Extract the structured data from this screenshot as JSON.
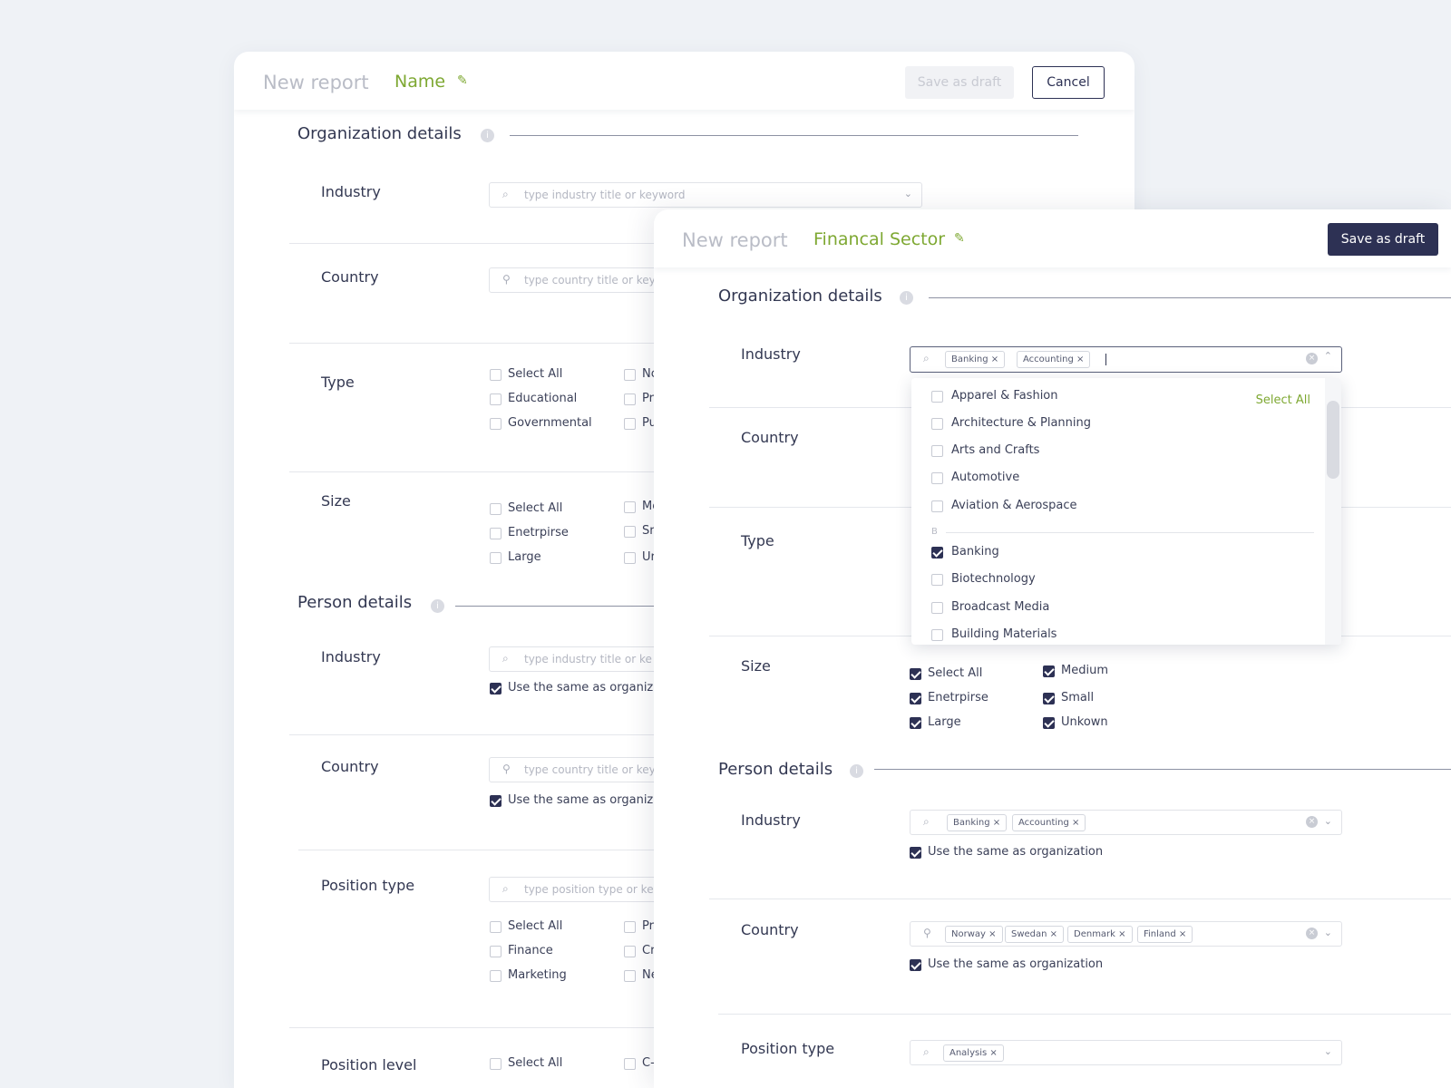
{
  "back": {
    "header": {
      "title": "New report",
      "name": "Name",
      "save_draft": "Save as draft",
      "cancel": "Cancel"
    },
    "org_title": "Organization details",
    "industry_label": "Industry",
    "industry_placeholder": "type industry title or keyword",
    "country_label": "Country",
    "country_placeholder": "type country title or keyword",
    "type_label": "Type",
    "type_options": [
      "Select All",
      "Educational",
      "Governmental"
    ],
    "type_options_col2": [
      "Nc",
      "Pr",
      "Pu"
    ],
    "size_label": "Size",
    "size_options": [
      "Select All",
      "Enetrpirse",
      "Large"
    ],
    "size_options_col2": [
      "Mc",
      "Sr",
      "Ur"
    ],
    "person_title": "Person details",
    "p_industry_label": "Industry",
    "p_industry_placeholder": "type industry title or ke",
    "p_industry_same": "Use the same as organizat",
    "p_country_label": "Country",
    "p_country_placeholder": "type country title or key",
    "p_country_same": "Use the same as organizat",
    "position_type_label": "Position type",
    "position_type_placeholder": "type position type or ke",
    "position_options": [
      "Select All",
      "Finance",
      "Marketing"
    ],
    "position_options_col2": [
      "Pr",
      "Cr",
      "Ne"
    ],
    "position_level_label": "Position level",
    "position_level_options": [
      "Select All"
    ],
    "position_level_col2": [
      "C-"
    ]
  },
  "front": {
    "header": {
      "title": "New report",
      "name": "Financal Sector",
      "save_draft": "Save as draft"
    },
    "org_title": "Organization details",
    "industry_label": "Industry",
    "industry_tags": [
      "Banking",
      "Accounting"
    ],
    "country_label": "Country",
    "type_label": "Type",
    "size_label": "Size",
    "size_options": [
      "Select All",
      "Enetrpirse",
      "Large"
    ],
    "size_options_col2": [
      "Medium",
      "Small",
      "Unkown"
    ],
    "dropdown": {
      "select_all": "Select All",
      "group_a_items": [
        "Apparel & Fashion",
        "Architecture & Planning",
        "Arts and Crafts",
        "Automotive",
        "Aviation & Aerospace"
      ],
      "group_b_letter": "B",
      "group_b_items": [
        "Banking",
        "Biotechnology",
        "Broadcast Media",
        "Building Materials"
      ]
    },
    "person_title": "Person details",
    "p_industry_label": "Industry",
    "p_industry_tags": [
      "Banking",
      "Accounting"
    ],
    "p_industry_same": "Use the same as organization",
    "p_country_label": "Country",
    "p_country_tags": [
      "Norway",
      "Swedan",
      "Denmark",
      "Finland"
    ],
    "p_country_same": "Use the same as organization",
    "position_type_label": "Position type",
    "position_type_tags": [
      "Analysis"
    ]
  },
  "colors": {
    "accent_green": "#7ea832",
    "primary_navy": "#2d3154"
  },
  "icons": {
    "search": "search-icon",
    "location": "location-pin-icon",
    "edit": "pencil-icon",
    "info": "info-icon"
  }
}
